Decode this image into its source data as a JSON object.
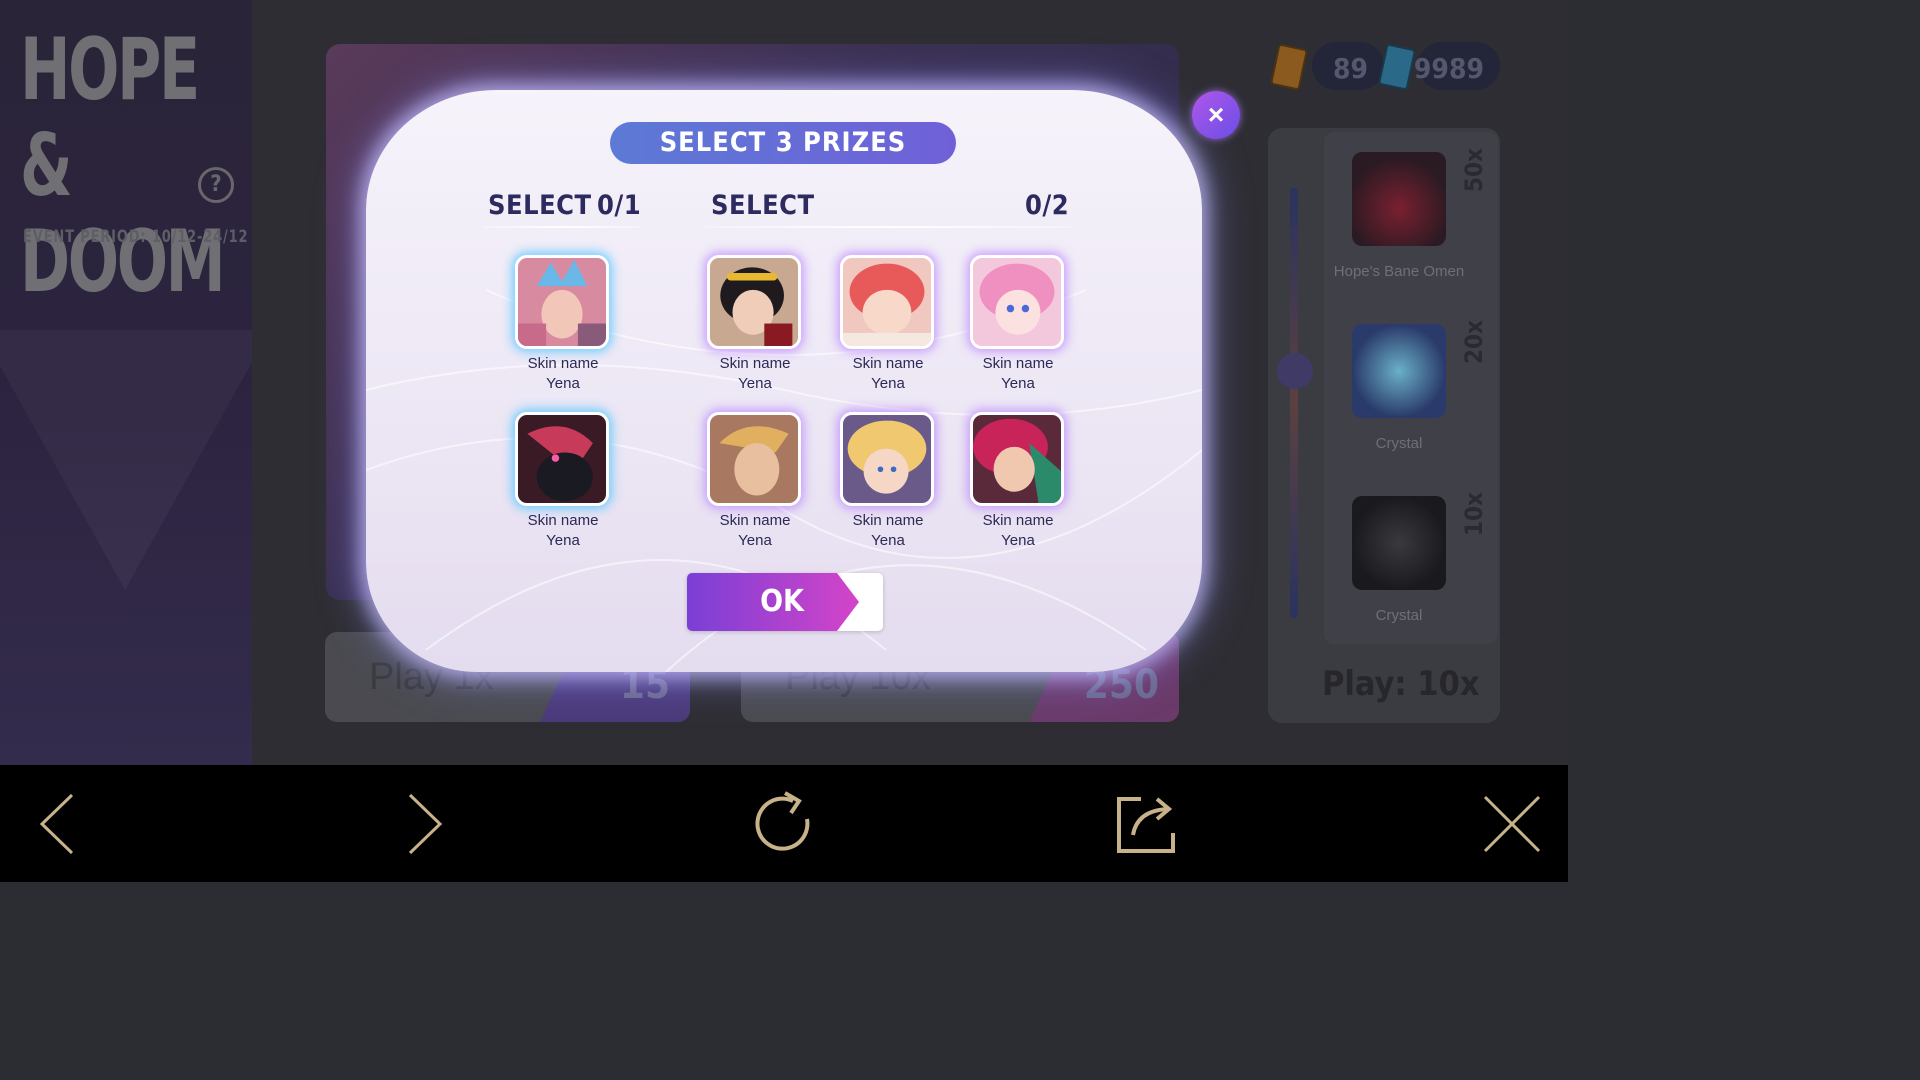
{
  "event": {
    "title": "HOPE &\nDOOM",
    "period": "EVENT PERIOD: 10/12-24/12"
  },
  "currency": {
    "tickets": "89",
    "diamonds": "9989"
  },
  "play_buttons": [
    {
      "label": "Play 1x",
      "cost": "15"
    },
    {
      "label": "Play 10x",
      "cost": "250"
    }
  ],
  "rewards": [
    {
      "name": "Hope's Bane Omen",
      "multiplier": "50x"
    },
    {
      "name": "Crystal",
      "multiplier": "20x"
    },
    {
      "name": "Crystal",
      "multiplier": "10x"
    }
  ],
  "play_count": "Play: 10x",
  "modal": {
    "title": "SELECT 3 PRIZES",
    "left_label": "SELECT",
    "left_count": "0/1",
    "right_label": "SELECT",
    "right_count": "0/2",
    "ok_label": "OK",
    "close_glyph": "×",
    "left_prizes": [
      {
        "skin": "Skin name",
        "hero": "Yena",
        "art": "crystal-knight"
      },
      {
        "skin": "Skin name",
        "hero": "Yena",
        "art": "dark-armor"
      }
    ],
    "right_prizes": [
      {
        "skin": "Skin name",
        "hero": "Yena",
        "art": "headband-girl"
      },
      {
        "skin": "Skin name",
        "hero": "Yena",
        "art": "red-hair-child"
      },
      {
        "skin": "Skin name",
        "hero": "Yena",
        "art": "pink-hair-girl"
      },
      {
        "skin": "Skin name",
        "hero": "Yena",
        "art": "blonde-man"
      },
      {
        "skin": "Skin name",
        "hero": "Yena",
        "art": "blonde-elf"
      },
      {
        "skin": "Skin name",
        "hero": "Yena",
        "art": "red-hair-woman"
      }
    ]
  },
  "colors": {
    "title_pill": "#6a6ad8",
    "ok_gradient_start": "#7a3fd6",
    "ok_gradient_end": "#d444c8",
    "text_dark": "#2c2a5e"
  },
  "bottom_nav": [
    "back-icon",
    "forward-icon",
    "refresh-icon",
    "share-icon",
    "close-icon"
  ]
}
